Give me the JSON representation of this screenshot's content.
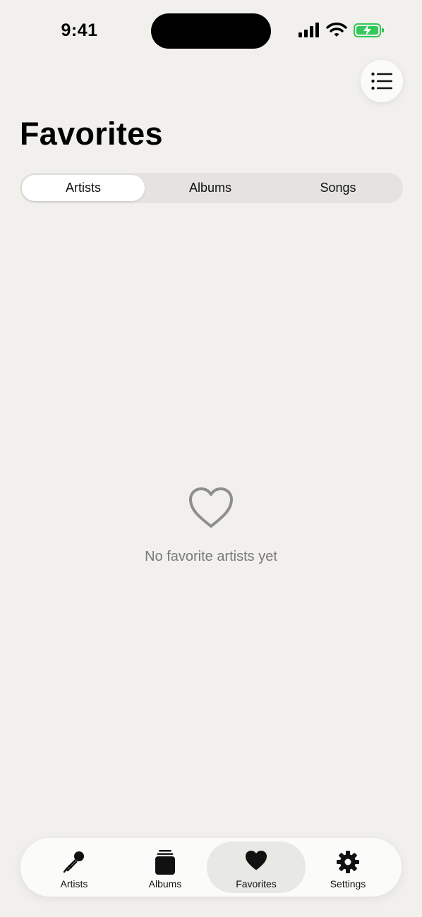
{
  "status_bar": {
    "time": "9:41",
    "signal_icon": "cellular-signal-icon",
    "wifi_icon": "wifi-icon",
    "battery_icon": "battery-charging-icon",
    "battery_color": "#34c759"
  },
  "header": {
    "menu_icon": "list-icon",
    "title": "Favorites"
  },
  "segments": {
    "items": [
      {
        "label": "Artists",
        "selected": true
      },
      {
        "label": "Albums",
        "selected": false
      },
      {
        "label": "Songs",
        "selected": false
      }
    ]
  },
  "empty_state": {
    "icon": "heart-outline-icon",
    "message": "No favorite artists yet"
  },
  "tab_bar": {
    "items": [
      {
        "label": "Artists",
        "icon": "microphone-icon",
        "selected": false
      },
      {
        "label": "Albums",
        "icon": "album-stack-icon",
        "selected": false
      },
      {
        "label": "Favorites",
        "icon": "heart-icon",
        "selected": true
      },
      {
        "label": "Settings",
        "icon": "gear-icon",
        "selected": false
      }
    ]
  }
}
